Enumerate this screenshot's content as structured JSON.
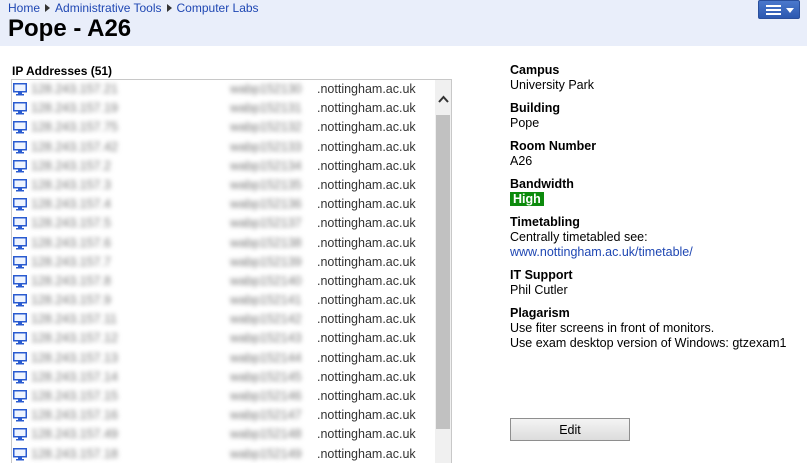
{
  "breadcrumb": [
    "Home",
    "Administrative Tools",
    "Computer Labs"
  ],
  "page_title": "Pope - A26",
  "ip_section": {
    "heading": "IP Addresses (51)",
    "rows": [
      {
        "ip": "128.243.157.21",
        "host_prefix": "wabp152130",
        "host_domain": ".nottingham.ac.uk"
      },
      {
        "ip": "128.243.157.19",
        "host_prefix": "wabp152131",
        "host_domain": ".nottingham.ac.uk"
      },
      {
        "ip": "128.243.157.75",
        "host_prefix": "wabp152132",
        "host_domain": ".nottingham.ac.uk"
      },
      {
        "ip": "128.243.157.42",
        "host_prefix": "wabp152133",
        "host_domain": ".nottingham.ac.uk"
      },
      {
        "ip": "128.243.157.2",
        "host_prefix": "wabp152134",
        "host_domain": ".nottingham.ac.uk"
      },
      {
        "ip": "128.243.157.3",
        "host_prefix": "wabp152135",
        "host_domain": ".nottingham.ac.uk"
      },
      {
        "ip": "128.243.157.4",
        "host_prefix": "wabp152136",
        "host_domain": ".nottingham.ac.uk"
      },
      {
        "ip": "128.243.157.5",
        "host_prefix": "wabp152137",
        "host_domain": ".nottingham.ac.uk"
      },
      {
        "ip": "128.243.157.6",
        "host_prefix": "wabp152138",
        "host_domain": ".nottingham.ac.uk"
      },
      {
        "ip": "128.243.157.7",
        "host_prefix": "wabp152139",
        "host_domain": ".nottingham.ac.uk"
      },
      {
        "ip": "128.243.157.8",
        "host_prefix": "wabp152140",
        "host_domain": ".nottingham.ac.uk"
      },
      {
        "ip": "128.243.157.9",
        "host_prefix": "wabp152141",
        "host_domain": ".nottingham.ac.uk"
      },
      {
        "ip": "128.243.157.11",
        "host_prefix": "wabp152142",
        "host_domain": ".nottingham.ac.uk"
      },
      {
        "ip": "128.243.157.12",
        "host_prefix": "wabp152143",
        "host_domain": ".nottingham.ac.uk"
      },
      {
        "ip": "128.243.157.13",
        "host_prefix": "wabp152144",
        "host_domain": ".nottingham.ac.uk"
      },
      {
        "ip": "128.243.157.14",
        "host_prefix": "wabp152145",
        "host_domain": ".nottingham.ac.uk"
      },
      {
        "ip": "128.243.157.15",
        "host_prefix": "wabp152146",
        "host_domain": ".nottingham.ac.uk"
      },
      {
        "ip": "128.243.157.16",
        "host_prefix": "wabp152147",
        "host_domain": ".nottingham.ac.uk"
      },
      {
        "ip": "128.243.157.49",
        "host_prefix": "wabp152148",
        "host_domain": ".nottingham.ac.uk"
      },
      {
        "ip": "128.243.157.18",
        "host_prefix": "wabp152149",
        "host_domain": ".nottingham.ac.uk"
      }
    ]
  },
  "details": {
    "campus_label": "Campus",
    "campus_value": "University Park",
    "building_label": "Building",
    "building_value": "Pope",
    "room_label": "Room Number",
    "room_value": "A26",
    "bandwidth_label": "Bandwidth",
    "bandwidth_value": "High",
    "timetabling_label": "Timetabling",
    "timetabling_value": "Centrally timetabled see:",
    "timetabling_link": "www.nottingham.ac.uk/timetable/",
    "support_label": "IT Support",
    "support_value": "Phil Cutler",
    "plagarism_label": "Plagarism",
    "plagarism_line1": "Use fiter screens in front of monitors.",
    "plagarism_line2": "Use exam desktop version of Windows: gtzexam1"
  },
  "edit_label": "Edit",
  "icons": {
    "menu": "hamburger-menu-icon",
    "computer": "desktop-computer-icon",
    "scroll_up": "chevron-up-icon"
  },
  "colors": {
    "topbar": "#e9eefa",
    "link": "#1f47b3",
    "badge_high": "#0c8a0c",
    "menu_button": "#2c58b0"
  }
}
